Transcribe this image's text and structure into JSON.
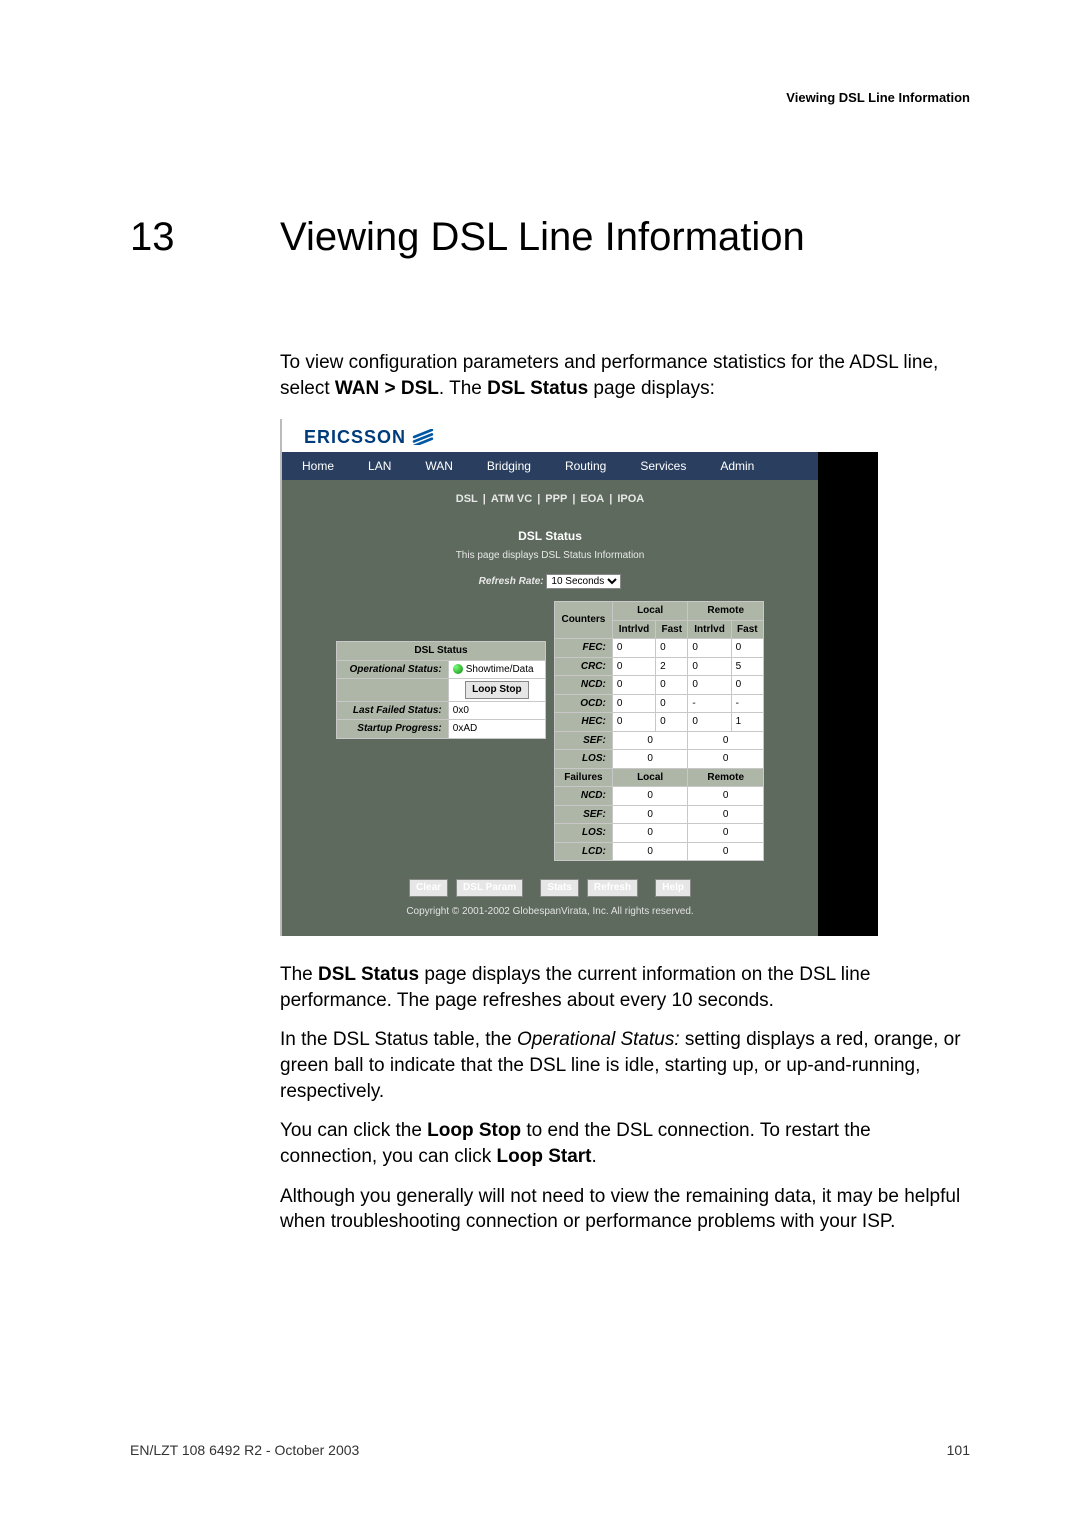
{
  "header_right": "Viewing DSL Line Information",
  "chapter": {
    "num": "13",
    "title": "Viewing DSL Line Information"
  },
  "intro_html": "To view configuration parameters and performance statistics for the ADSL line, select <span class=\"strong\">WAN &gt; DSL</span>. The <span class=\"strong\">DSL Status</span> page displays:",
  "brand": "ERICSSON",
  "tabs": [
    "Home",
    "LAN",
    "WAN",
    "Bridging",
    "Routing",
    "Services",
    "Admin"
  ],
  "subnav": [
    "DSL",
    "ATM VC",
    "PPP",
    "EOA",
    "IPOA"
  ],
  "panel_title": "DSL Status",
  "panel_desc": "This page displays DSL Status Information",
  "refresh_label": "Refresh Rate:",
  "refresh_value": "10 Seconds",
  "dsl_status_title": "DSL Status",
  "status_rows": [
    {
      "label": "Operational Status:",
      "value_html": "<span class=\"led\" data-name=\"status-led-icon\" data-interactable=\"false\"></span>Showtime/Data",
      "extra": "Loop Stop"
    },
    {
      "label": "Last Failed Status:",
      "value": "0x0"
    },
    {
      "label": "Startup Progress:",
      "value": "0xAD"
    }
  ],
  "counters_title": "Counters",
  "regions": [
    "Local",
    "Remote"
  ],
  "subcols": [
    "Intrlvd",
    "Fast",
    "Intrlvd",
    "Fast"
  ],
  "counter_rows": [
    {
      "name": "FEC:",
      "vals": [
        "0",
        "0",
        "0",
        "0"
      ]
    },
    {
      "name": "CRC:",
      "vals": [
        "0",
        "2",
        "0",
        "5"
      ]
    },
    {
      "name": "NCD:",
      "vals": [
        "0",
        "0",
        "0",
        "0"
      ]
    },
    {
      "name": "OCD:",
      "vals": [
        "0",
        "0",
        "-",
        "-"
      ]
    },
    {
      "name": "HEC:",
      "vals": [
        "0",
        "0",
        "0",
        "1"
      ]
    }
  ],
  "merged_rows": [
    {
      "name": "SEF:",
      "vals": [
        "0",
        "0"
      ]
    },
    {
      "name": "LOS:",
      "vals": [
        "0",
        "0"
      ]
    }
  ],
  "failures_title": "Failures",
  "failure_regions": [
    "Local",
    "Remote"
  ],
  "failure_rows": [
    {
      "name": "NCD:",
      "vals": [
        "0",
        "0"
      ]
    },
    {
      "name": "SEF:",
      "vals": [
        "0",
        "0"
      ]
    },
    {
      "name": "LOS:",
      "vals": [
        "0",
        "0"
      ]
    },
    {
      "name": "LCD:",
      "vals": [
        "0",
        "0"
      ]
    }
  ],
  "buttons": [
    "Clear",
    "DSL Param",
    "Stats",
    "Refresh",
    "Help"
  ],
  "shot_copyright": "Copyright © 2001-2002 GlobespanVirata, Inc. All rights reserved.",
  "para2_html": "The <span class=\"strong\">DSL Status</span> page displays the current information on the DSL line performance. The page refreshes about every 10 seconds.",
  "para3_html": "In the DSL Status table, the <span class=\"ital\">Operational Status:</span> setting displays a red, orange, or green ball to indicate that the DSL line is idle, starting up, or up-and-running, respectively.",
  "para4_html": "You can click the <span class=\"strong\">Loop Stop</span> to end the DSL connection. To restart the connection, you can click <span class=\"strong\">Loop Start</span>.",
  "para5": "Although you generally will not need to view the remaining data, it may be helpful when troubleshooting connection or performance problems with your ISP.",
  "footer_left": "EN/LZT 108 6492 R2 - October 2003",
  "footer_right": "101"
}
